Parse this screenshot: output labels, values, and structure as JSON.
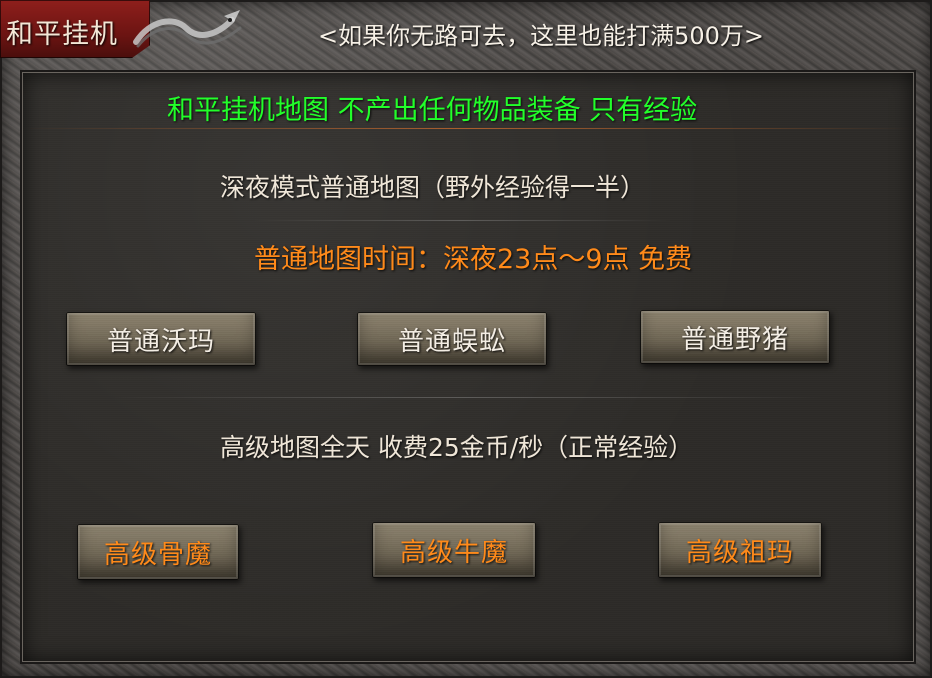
{
  "header": {
    "tab_title": "和平挂机",
    "subtitle": "<如果你无路可去，这里也能打满500万>",
    "decor_icon": "dragon-icon"
  },
  "panel": {
    "headline": "和平挂机地图   不产出任何物品装备   只有经验",
    "night_mode_text": "深夜模式普通地图（野外经验得一半）",
    "normal_time_text": "普通地图时间：深夜23点～9点  免费",
    "normal_maps": [
      {
        "label": "普通沃玛"
      },
      {
        "label": "普通蜈蚣"
      },
      {
        "label": "普通野猪"
      }
    ],
    "advanced_text": "高级地图全天   收费25金币/秒（正常经验）",
    "advanced_maps": [
      {
        "label": "高级骨魔"
      },
      {
        "label": "高级牛魔"
      },
      {
        "label": "高级祖玛"
      }
    ]
  },
  "colors": {
    "green": "#22ff2a",
    "orange": "#ff8a1a",
    "cream": "#efe6d8",
    "tab_red": "#8f1f1c"
  }
}
